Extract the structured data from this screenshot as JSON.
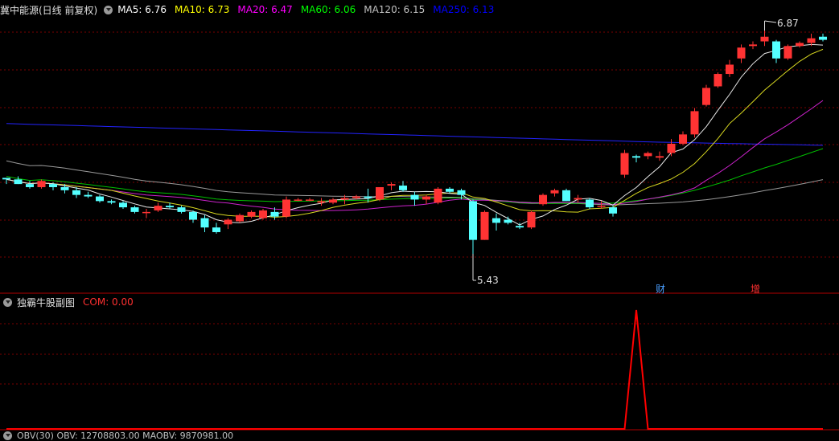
{
  "main_header": {
    "stock_title": "冀中能源(日线 前复权)",
    "indicators": [
      {
        "label": "MA5: 6.76",
        "color": "#ffffff"
      },
      {
        "label": "MA10: 6.73",
        "color": "#ffff00"
      },
      {
        "label": "MA20: 6.47",
        "color": "#ff00ff"
      },
      {
        "label": "MA60: 6.06",
        "color": "#00ff00"
      },
      {
        "label": "MA120: 6.15",
        "color": "#c0c0c0"
      },
      {
        "label": "MA250: 6.13",
        "color": "#0000ff"
      }
    ]
  },
  "price_markers": {
    "high": "6.87",
    "low": "5.43"
  },
  "event_tags": [
    {
      "label": "财",
      "color": "#4a9fff"
    },
    {
      "label": "增",
      "color": "#ff3030"
    }
  ],
  "sub_header": {
    "title": "独霸牛股副图",
    "com_label": "COM: 0.00"
  },
  "bottom_header": {
    "text": "OBV(30)  OBV: 12708803.00  MAOBV: 9870981.00"
  },
  "colors": {
    "up": "#ff3333",
    "down": "#54ffff",
    "grid": "#7a0000",
    "com_line": "#ff0000"
  },
  "chart_data": {
    "type": "candlestick",
    "price_range": [
      5.43,
      6.87
    ],
    "candles_ohlc": [
      [
        5.92,
        5.92,
        5.88,
        5.91
      ],
      [
        5.91,
        5.93,
        5.88,
        5.88
      ],
      [
        5.88,
        5.9,
        5.85,
        5.86
      ],
      [
        5.86,
        5.91,
        5.85,
        5.9
      ],
      [
        5.88,
        5.89,
        5.84,
        5.86
      ],
      [
        5.86,
        5.88,
        5.82,
        5.84
      ],
      [
        5.84,
        5.86,
        5.79,
        5.81
      ],
      [
        5.81,
        5.83,
        5.79,
        5.8
      ],
      [
        5.8,
        5.81,
        5.76,
        5.77
      ],
      [
        5.77,
        5.78,
        5.75,
        5.76
      ],
      [
        5.76,
        5.77,
        5.72,
        5.73
      ],
      [
        5.73,
        5.74,
        5.69,
        5.7
      ],
      [
        5.7,
        5.72,
        5.66,
        5.7
      ],
      [
        5.71,
        5.76,
        5.7,
        5.74
      ],
      [
        5.74,
        5.76,
        5.72,
        5.73
      ],
      [
        5.73,
        5.74,
        5.69,
        5.7
      ],
      [
        5.7,
        5.71,
        5.63,
        5.65
      ],
      [
        5.66,
        5.68,
        5.57,
        5.6
      ],
      [
        5.6,
        5.63,
        5.56,
        5.57
      ],
      [
        5.62,
        5.66,
        5.59,
        5.65
      ],
      [
        5.64,
        5.69,
        5.63,
        5.68
      ],
      [
        5.67,
        5.71,
        5.66,
        5.7
      ],
      [
        5.66,
        5.72,
        5.65,
        5.71
      ],
      [
        5.7,
        5.73,
        5.65,
        5.67
      ],
      [
        5.67,
        5.8,
        5.66,
        5.78
      ],
      [
        5.78,
        5.79,
        5.77,
        5.78
      ],
      [
        5.78,
        5.79,
        5.77,
        5.78
      ],
      [
        5.76,
        5.79,
        5.74,
        5.77
      ],
      [
        5.76,
        5.79,
        5.75,
        5.78
      ],
      [
        5.78,
        5.81,
        5.75,
        5.79
      ],
      [
        5.79,
        5.81,
        5.78,
        5.8
      ],
      [
        5.8,
        5.85,
        5.76,
        5.79
      ],
      [
        5.78,
        5.86,
        5.77,
        5.86
      ],
      [
        5.87,
        5.89,
        5.84,
        5.88
      ],
      [
        5.87,
        5.9,
        5.83,
        5.84
      ],
      [
        5.81,
        5.83,
        5.74,
        5.78
      ],
      [
        5.78,
        5.81,
        5.75,
        5.8
      ],
      [
        5.76,
        5.86,
        5.75,
        5.85
      ],
      [
        5.85,
        5.86,
        5.82,
        5.83
      ],
      [
        5.84,
        5.85,
        5.78,
        5.81
      ],
      [
        5.77,
        5.78,
        5.43,
        5.52
      ],
      [
        5.52,
        5.71,
        5.52,
        5.7
      ],
      [
        5.66,
        5.69,
        5.58,
        5.63
      ],
      [
        5.65,
        5.67,
        5.62,
        5.63
      ],
      [
        5.61,
        5.63,
        5.59,
        5.6
      ],
      [
        5.6,
        5.71,
        5.59,
        5.7
      ],
      [
        5.75,
        5.82,
        5.74,
        5.81
      ],
      [
        5.82,
        5.85,
        5.8,
        5.84
      ],
      [
        5.84,
        5.85,
        5.77,
        5.77
      ],
      [
        5.78,
        5.81,
        5.76,
        5.79
      ],
      [
        5.78,
        5.79,
        5.72,
        5.73
      ],
      [
        5.74,
        5.77,
        5.72,
        5.74
      ],
      [
        5.73,
        5.74,
        5.67,
        5.69
      ],
      [
        5.94,
        6.1,
        5.92,
        6.08
      ],
      [
        6.06,
        6.07,
        6.02,
        6.05
      ],
      [
        6.06,
        6.09,
        6.04,
        6.08
      ],
      [
        6.05,
        6.09,
        6.03,
        6.06
      ],
      [
        6.08,
        6.17,
        6.06,
        6.14
      ],
      [
        6.14,
        6.22,
        6.13,
        6.2
      ],
      [
        6.2,
        6.37,
        6.18,
        6.35
      ],
      [
        6.39,
        6.52,
        6.38,
        6.5
      ],
      [
        6.51,
        6.6,
        6.5,
        6.59
      ],
      [
        6.59,
        6.68,
        6.57,
        6.65
      ],
      [
        6.69,
        6.78,
        6.66,
        6.76
      ],
      [
        6.77,
        6.8,
        6.75,
        6.78
      ],
      [
        6.8,
        6.87,
        6.77,
        6.83
      ],
      [
        6.8,
        6.81,
        6.66,
        6.69
      ],
      [
        6.69,
        6.78,
        6.68,
        6.77
      ],
      [
        6.77,
        6.8,
        6.76,
        6.79
      ],
      [
        6.79,
        6.85,
        6.77,
        6.82
      ],
      [
        6.83,
        6.85,
        6.8,
        6.81
      ]
    ],
    "ma250": [
      6.27,
      6.24,
      6.21,
      6.18,
      6.15,
      6.13
    ],
    "com_values": [
      0,
      0,
      0,
      0,
      0,
      0,
      0,
      0,
      0,
      0,
      0,
      0,
      0,
      0,
      0,
      0,
      0,
      0,
      0,
      0,
      0,
      0,
      0,
      0,
      0,
      0,
      0,
      0,
      0,
      0,
      0,
      0,
      0,
      0,
      0,
      0,
      0,
      0,
      0,
      0,
      0,
      0,
      0,
      0,
      0,
      0,
      0,
      0,
      0,
      0,
      0,
      0,
      0,
      0,
      1,
      0,
      0,
      0,
      0,
      0,
      0,
      0,
      0,
      0,
      0,
      0,
      0,
      0,
      0,
      0,
      0
    ]
  }
}
